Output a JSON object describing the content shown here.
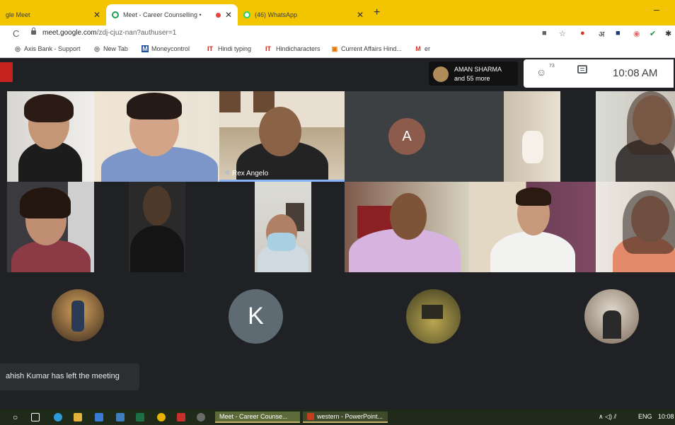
{
  "browser": {
    "tabs": [
      {
        "title": "gle Meet",
        "active": false
      },
      {
        "title": "Meet - Career Counselling •",
        "active": true
      },
      {
        "title": "(46) WhatsApp",
        "active": false
      }
    ],
    "new_tab": "+",
    "minimize": "–",
    "url_host": "meet.google.com",
    "url_path": "/zdj-cjuz-nan?authuser=1",
    "bookmarks": [
      {
        "label": "Axis Bank - Support",
        "icon": "globe-icon",
        "glyph": "◎"
      },
      {
        "label": "New Tab",
        "icon": "globe-icon",
        "glyph": "◎"
      },
      {
        "label": "Moneycontrol",
        "icon": "moneycontrol-icon",
        "glyph": "M"
      },
      {
        "label": "Hindi typing",
        "icon": "it-logo-icon",
        "glyph": "IT"
      },
      {
        "label": "Hindicharacters",
        "icon": "it-logo-icon",
        "glyph": "IT"
      },
      {
        "label": "Current Affairs Hind...",
        "icon": "page-icon",
        "glyph": "▣"
      },
      {
        "label": "er",
        "icon": "gmail-icon",
        "glyph": "M"
      }
    ]
  },
  "meet": {
    "presenter": {
      "name": "AMAN SHARMA",
      "more": "and 55 more"
    },
    "people_count": "73",
    "time": "10:08 AM",
    "speaker_name": "Rex Angelo",
    "avatars_letters": [
      "A",
      "K"
    ],
    "toast": "ahish Kumar has left the meeting",
    "colors": {
      "accent": "#8ab4f8",
      "background": "#202124",
      "avatar_a": "#8d5b4c",
      "avatar_k": "#5f6b73"
    }
  },
  "taskbar": {
    "apps": [
      {
        "label": "Meet - Career Counse..."
      },
      {
        "label": "western - PowerPoint..."
      }
    ],
    "tray_lang": "ENG",
    "tray_time": "10:08",
    "tray_symbols": "∧ ◁) ⫽"
  }
}
